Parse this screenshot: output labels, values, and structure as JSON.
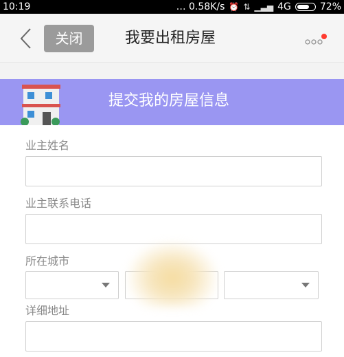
{
  "status_bar": {
    "time": "10:19",
    "network_speed": "… 0.58K/s",
    "network_type": "4G",
    "battery_percent": "72%",
    "battery_level": 0.72
  },
  "header": {
    "close_label": "关闭",
    "title": "我要出租房屋"
  },
  "banner": {
    "title": "提交我的房屋信息",
    "color": "#9a96f2"
  },
  "form": {
    "owner_name": {
      "label": "业主姓名",
      "value": ""
    },
    "owner_phone": {
      "label": "业主联系电话",
      "value": ""
    },
    "city": {
      "label": "所在城市"
    },
    "address": {
      "label": "详细地址",
      "value": ""
    }
  },
  "colors": {
    "notification_dot": "#ff3b30"
  }
}
